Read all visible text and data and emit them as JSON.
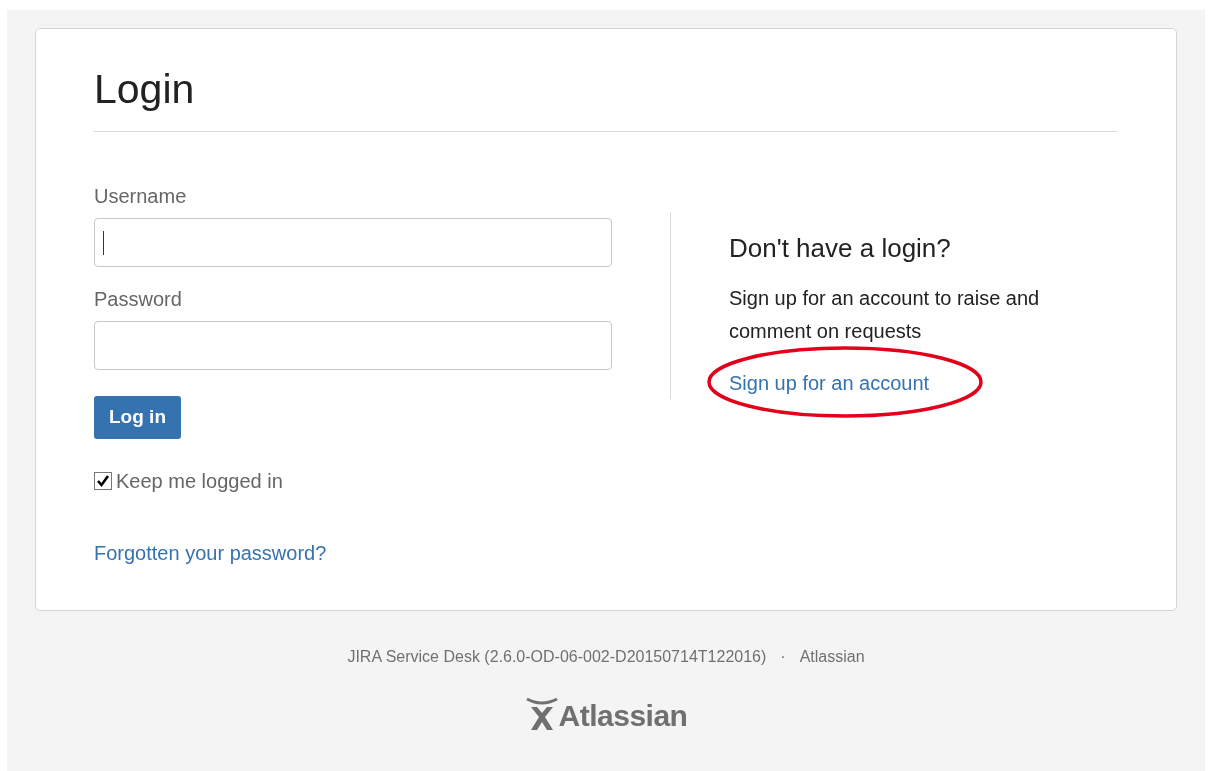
{
  "login_card": {
    "title": "Login",
    "username": {
      "label": "Username",
      "focused": true
    },
    "password": {
      "label": "Password"
    },
    "submit_button": "Log in",
    "keep_logged_in": {
      "label": "Keep me logged in",
      "checked": true
    },
    "forgot_link": "Forgotten your password?",
    "signup": {
      "heading": "Don't have a login?",
      "text": "Sign up for an account to raise and comment on requests",
      "link": "Sign up for an account",
      "circled": true
    }
  },
  "footer": {
    "version": "JIRA Service Desk (2.6.0-OD-06-002-D20150714T122016)",
    "separator": "·",
    "company_link": "Atlassian",
    "logo_text": "Atlassian"
  }
}
